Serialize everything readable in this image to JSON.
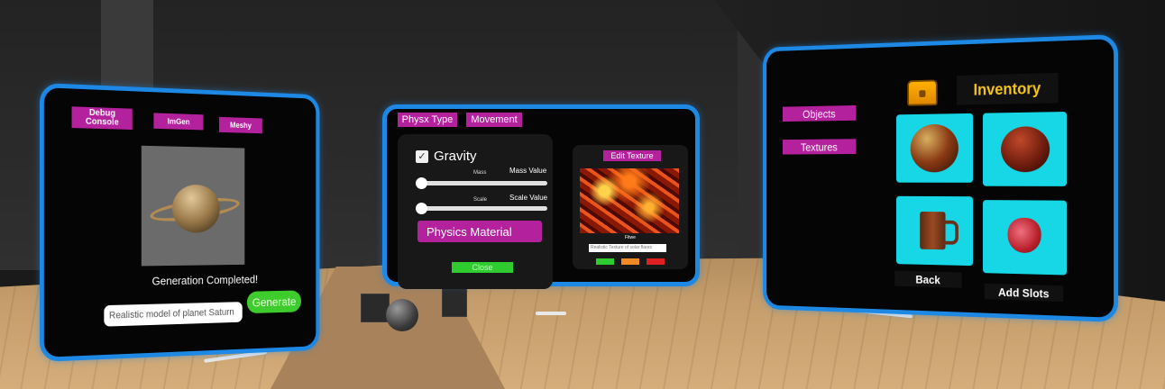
{
  "left_panel": {
    "tabs": [
      "Debug Console",
      "ImGen",
      "Meshy"
    ],
    "status": "Generation Completed!",
    "prompt_value": "Realistic model of planet Saturn",
    "generate_label": "Generate"
  },
  "middle_panel": {
    "tabs": [
      "Physx Type",
      "Movement"
    ],
    "gravity_label": "Gravity",
    "gravity_checked": true,
    "mass_label": "Mass",
    "mass_value": "Mass Value",
    "scale_label": "Scale",
    "scale_value": "Scale Value",
    "physics_material_label": "Physics Material",
    "close_label": "Close",
    "edit_texture_label": "Edit Texture",
    "texture_caption": "Fitwe",
    "texture_prompt": "Realistic Texture of solar flares",
    "mini_buttons": [
      {
        "label": "",
        "color": "#2ecc2e"
      },
      {
        "label": "",
        "color": "#f08a24"
      },
      {
        "label": "",
        "color": "#e02020"
      }
    ]
  },
  "right_panel": {
    "menu": [
      "Objects",
      "Textures"
    ],
    "title": "Inventory",
    "slots": [
      "sphere-red-mottled",
      "sphere-dark-red",
      "wooden-mug",
      "anatomical-heart"
    ],
    "back_label": "Back",
    "add_slots_label": "Add Slots"
  },
  "colors": {
    "panel_border": "#1e88e5",
    "magenta": "#b4219c",
    "slot_bg": "#17d6e6",
    "accent_green": "#3ecb2c",
    "title_gold": "#f5c518"
  }
}
